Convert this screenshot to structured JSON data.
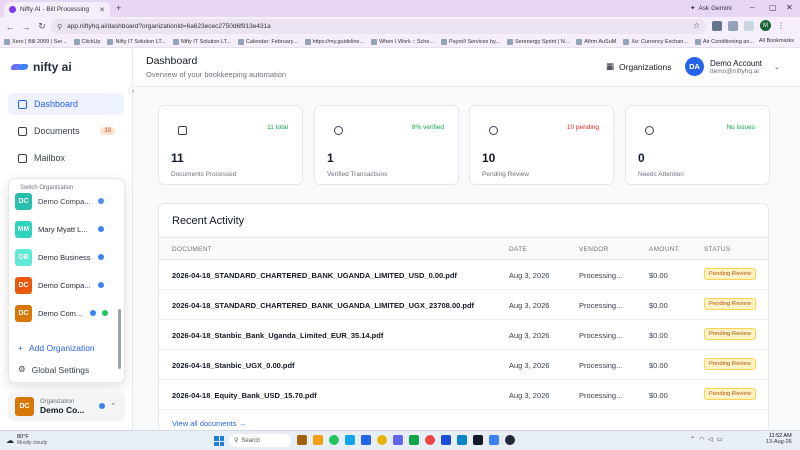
{
  "browser": {
    "tab_title": "Nifty AI - Bill Processing",
    "url": "app.niftyhq.ai/dashboard?organizationId=6a623ecec2750d6f913e431a",
    "ask_gemini": "Ask Gemini",
    "profile_initial": "M",
    "bookmarks": [
      "Xero | Bill 2009 | Ser...",
      "ClickUp",
      "Nifty IT Solution LT...",
      "Nifty IT Solution LT...",
      "Calendar: February...",
      "https://my.guideline...",
      "When I Work :: Sche...",
      "Payroll Services by...",
      "Serenergy Sprint | N...",
      "Afirm AuSuM",
      "Xe: Currency Exchan...",
      "Air Conditioning an..."
    ],
    "all_bookmarks": "All Bookmarks"
  },
  "brand": {
    "name": "nifty ai"
  },
  "sidebar": {
    "nav": [
      {
        "label": "Dashboard",
        "active": true
      },
      {
        "label": "Documents",
        "badge": "10"
      },
      {
        "label": "Mailbox"
      }
    ],
    "switcher": {
      "title": "Switch Organization",
      "orgs": [
        {
          "initials": "DC",
          "name": "Demo Compa...",
          "color": "#14b8a6"
        },
        {
          "initials": "MM",
          "name": "Mary Myatt L...",
          "color": "#2dd4bf"
        },
        {
          "initials": "DB",
          "name": "Demo Business",
          "color": "#5eead4"
        },
        {
          "initials": "DC",
          "name": "Demo Compa...",
          "color": "#ea580c"
        },
        {
          "initials": "DC",
          "name": "Demo Com...",
          "color": "#d97706"
        }
      ],
      "add_label": "Add Organization",
      "settings_label": "Global Settings"
    },
    "current_org": {
      "label": "Organization",
      "initials": "DC",
      "name": "Demo Co..."
    }
  },
  "header": {
    "title": "Dashboard",
    "subtitle": "Overview of your bookkeeping automation",
    "orgs_button": "Organizations",
    "account": {
      "initials": "DA",
      "name": "Demo Account",
      "email": "demo@niftyhq.ai"
    }
  },
  "stats": [
    {
      "value": "11",
      "label": "Documents Processed",
      "trend": "11 total",
      "trend_color": "#16a34a"
    },
    {
      "value": "1",
      "label": "Verified Transactions",
      "trend": "9% verified",
      "trend_color": "#16a34a"
    },
    {
      "value": "10",
      "label": "Pending Review",
      "trend": "10 pending",
      "trend_color": "#dc2626"
    },
    {
      "value": "0",
      "label": "Needs Attention",
      "trend": "No issues",
      "trend_color": "#16a34a"
    }
  ],
  "activity": {
    "title": "Recent Activity",
    "columns": [
      "DOCUMENT",
      "DATE",
      "VENDOR",
      "AMOUNT",
      "STATUS"
    ],
    "rows": [
      {
        "document": "2026-04-18_STANDARD_CHARTERED_BANK_UGANDA_LIMITED_USD_0.00.pdf",
        "date": "Aug 3, 2026",
        "vendor": "Processing...",
        "amount": "$0.00",
        "status": "Pending Review"
      },
      {
        "document": "2026-04-18_STANDARD_CHARTERED_BANK_UGANDA_LIMITED_UGX_23708.00.pdf",
        "date": "Aug 3, 2026",
        "vendor": "Processing...",
        "amount": "$0.00",
        "status": "Pending Review"
      },
      {
        "document": "2026-04-18_Stanbic_Bank_Uganda_Limited_EUR_35.14.pdf",
        "date": "Aug 3, 2026",
        "vendor": "Processing...",
        "amount": "$0.00",
        "status": "Pending Review"
      },
      {
        "document": "2026-04-18_Stanbic_UGX_0.00.pdf",
        "date": "Aug 3, 2026",
        "vendor": "Processing...",
        "amount": "$0.00",
        "status": "Pending Review"
      },
      {
        "document": "2026-04-18_Equity_Bank_USD_15.70.pdf",
        "date": "Aug 3, 2026",
        "vendor": "Processing...",
        "amount": "$0.00",
        "status": "Pending Review"
      }
    ],
    "view_all": "View all documents →"
  },
  "taskbar": {
    "weather_temp": "80°F",
    "weather_desc": "Mostly cloudy",
    "search_placeholder": "Search",
    "time": "11:52 AM",
    "date": "13-Aug-26"
  },
  "colors": {
    "accent": "#2563eb",
    "pending_bg": "#fef3c7",
    "pending_text": "#b45309"
  }
}
